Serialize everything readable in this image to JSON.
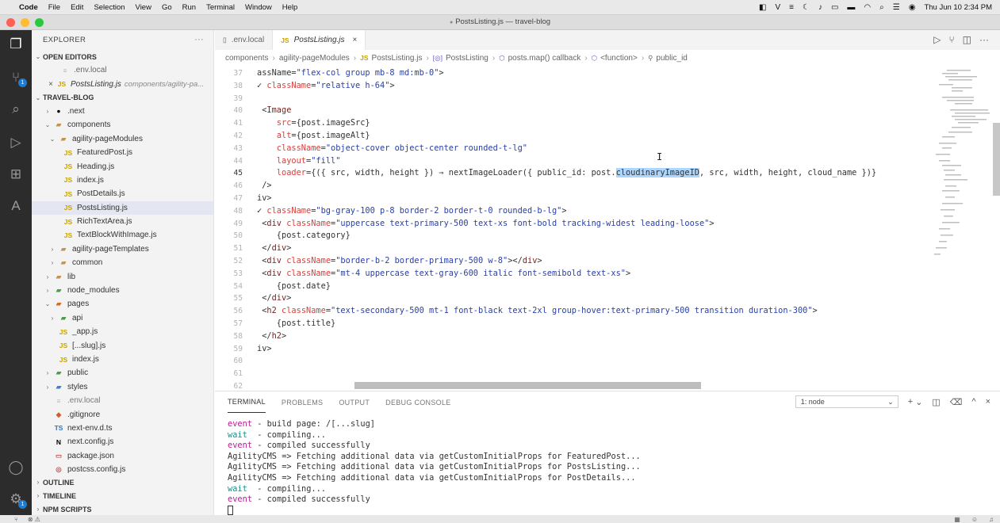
{
  "menubar": {
    "app": "Code",
    "items": [
      "File",
      "Edit",
      "Selection",
      "View",
      "Go",
      "Run",
      "Terminal",
      "Window",
      "Help"
    ],
    "clock": "Thu Jun 10  2:34 PM"
  },
  "window": {
    "title": "PostsListing.js — travel-blog",
    "dirty_dot": "●"
  },
  "activity": {
    "scm_badge": "1",
    "settings_badge": "1"
  },
  "sidebar": {
    "header": "EXPLORER",
    "more": "···",
    "open_editors": {
      "title": "OPEN EDITORS",
      "items": [
        {
          "icon": "≡",
          "label": ".env.local",
          "desc": ""
        },
        {
          "icon": "JS",
          "label": "PostsListing.js",
          "desc": "components/agility-pa..."
        }
      ]
    },
    "project": {
      "title": "TRAVEL-BLOG",
      "items": [
        {
          "chev": "›",
          "icon": "●",
          "label": ".next"
        },
        {
          "chev": "⌄",
          "icon": "▰",
          "label": "components"
        },
        {
          "chev": "⌄",
          "icon": "▰",
          "label": "agility-pageModules"
        },
        {
          "chev": "",
          "icon": "JS",
          "label": "FeaturedPost.js"
        },
        {
          "chev": "",
          "icon": "JS",
          "label": "Heading.js"
        },
        {
          "chev": "",
          "icon": "JS",
          "label": "index.js"
        },
        {
          "chev": "",
          "icon": "JS",
          "label": "PostDetails.js"
        },
        {
          "chev": "",
          "icon": "JS",
          "label": "PostsListing.js"
        },
        {
          "chev": "",
          "icon": "JS",
          "label": "RichTextArea.js"
        },
        {
          "chev": "",
          "icon": "JS",
          "label": "TextBlockWithImage.js"
        },
        {
          "chev": "›",
          "icon": "▰",
          "label": "agility-pageTemplates"
        },
        {
          "chev": "›",
          "icon": "▰",
          "label": "common"
        },
        {
          "chev": "›",
          "icon": "▰",
          "label": "lib"
        },
        {
          "chev": "›",
          "icon": "▰",
          "label": "node_modules"
        },
        {
          "chev": "⌄",
          "icon": "▰",
          "label": "pages"
        },
        {
          "chev": "›",
          "icon": "▰",
          "label": "api"
        },
        {
          "chev": "",
          "icon": "JS",
          "label": "_app.js"
        },
        {
          "chev": "",
          "icon": "JS",
          "label": "[...slug].js"
        },
        {
          "chev": "",
          "icon": "JS",
          "label": "index.js"
        },
        {
          "chev": "›",
          "icon": "▰",
          "label": "public"
        },
        {
          "chev": "›",
          "icon": "▰",
          "label": "styles"
        },
        {
          "chev": "",
          "icon": "≡",
          "label": ".env.local"
        },
        {
          "chev": "",
          "icon": "◆",
          "label": ".gitignore"
        },
        {
          "chev": "",
          "icon": "TS",
          "label": "next-env.d.ts"
        },
        {
          "chev": "",
          "icon": "N",
          "label": "next.config.js"
        },
        {
          "chev": "",
          "icon": "▭",
          "label": "package.json"
        },
        {
          "chev": "",
          "icon": "◎",
          "label": "postcss.config.js"
        }
      ]
    },
    "bottom_sections": [
      "OUTLINE",
      "TIMELINE",
      "NPM SCRIPTS"
    ]
  },
  "editor": {
    "tabs": [
      {
        "icon": "▯",
        "label": ".env.local",
        "close": ""
      },
      {
        "icon": "JS",
        "label": "PostsListing.js",
        "close": "×"
      }
    ],
    "breadcrumbs": [
      "components",
      "agility-pageModules",
      "PostsListing.js",
      "PostsListing",
      "posts.map() callback",
      "<function>",
      "public_id"
    ],
    "breadcrumb_sep": "›",
    "lines": [
      {
        "n": "37",
        "t": "assName=\"flex-col group mb-8 md:mb-0\">"
      },
      {
        "n": "38",
        "t": "✓ className=\"relative h-64\">"
      },
      {
        "n": "39",
        "t": ""
      },
      {
        "n": "40",
        "t": " <Image"
      },
      {
        "n": "41",
        "t": "    src={post.imageSrc}"
      },
      {
        "n": "42",
        "t": "    alt={post.imageAlt}"
      },
      {
        "n": "43",
        "t": "    className=\"object-cover object-center rounded-t-lg\""
      },
      {
        "n": "44",
        "t": "    layout=\"fill\""
      },
      {
        "n": "45",
        "t": "    loader={({ src, width, height }) ⇒ nextImageLoader({ public_id: post.cloudinaryImageID, src, width, height, cloud_name })}"
      },
      {
        "n": "46",
        "t": " />"
      },
      {
        "n": "47",
        "t": "iv>"
      },
      {
        "n": "48",
        "t": "✓ className=\"bg-gray-100 p-8 border-2 border-t-0 rounded-b-lg\">"
      },
      {
        "n": "49",
        "t": " <div className=\"uppercase text-primary-500 text-xs font-bold tracking-widest leading-loose\">"
      },
      {
        "n": "50",
        "t": "    {post.category}"
      },
      {
        "n": "51",
        "t": " </div>"
      },
      {
        "n": "52",
        "t": " <div className=\"border-b-2 border-primary-500 w-8\"></div>"
      },
      {
        "n": "53",
        "t": " <div className=\"mt-4 uppercase text-gray-600 italic font-semibold text-xs\">"
      },
      {
        "n": "54",
        "t": "    {post.date}"
      },
      {
        "n": "55",
        "t": " </div>"
      },
      {
        "n": "56",
        "t": " <h2 className=\"text-secondary-500 mt-1 font-black text-2xl group-hover:text-primary-500 transition duration-300\">"
      },
      {
        "n": "57",
        "t": "    {post.title}"
      },
      {
        "n": "58",
        "t": " </h2>"
      },
      {
        "n": "59",
        "t": "iv>"
      },
      {
        "n": "60",
        "t": ""
      },
      {
        "n": "61",
        "t": ""
      },
      {
        "n": "62",
        "t": ""
      }
    ],
    "current_line": "45",
    "selection_text": "cloudinaryImageID",
    "mouse_cursor": "I"
  },
  "panel": {
    "tabs": [
      "TERMINAL",
      "PROBLEMS",
      "OUTPUT",
      "DEBUG CONSOLE"
    ],
    "terminal_select": "1: node",
    "dropdown": "⌄",
    "controls": [
      "+",
      "⌄",
      "◫",
      "🗑",
      "^",
      "×"
    ],
    "terminal_lines": [
      {
        "kind": "event",
        "prefix": "event",
        "text": " - build page: /[...slug]"
      },
      {
        "kind": "wait",
        "prefix": "wait",
        "text": "  - compiling..."
      },
      {
        "kind": "event",
        "prefix": "event",
        "text": " - compiled successfully"
      },
      {
        "kind": "plain",
        "prefix": "",
        "text": "AgilityCMS => Fetching additional data via getCustomInitialProps for FeaturedPost..."
      },
      {
        "kind": "plain",
        "prefix": "",
        "text": "AgilityCMS => Fetching additional data via getCustomInitialProps for PostsListing..."
      },
      {
        "kind": "plain",
        "prefix": "",
        "text": "AgilityCMS => Fetching additional data via getCustomInitialProps for PostDetails..."
      },
      {
        "kind": "wait",
        "prefix": "wait",
        "text": "  - compiling..."
      },
      {
        "kind": "event",
        "prefix": "event",
        "text": " - compiled successfully"
      }
    ]
  },
  "colors": {
    "activity_bg": "#2c2c2c",
    "sidebar_bg": "#f3f3f3",
    "selection": "#add6ff",
    "attr": "#d7413d",
    "string": "#2a3fa5",
    "terminal_event": "#bd1d92",
    "terminal_wait": "#1f8f86"
  }
}
